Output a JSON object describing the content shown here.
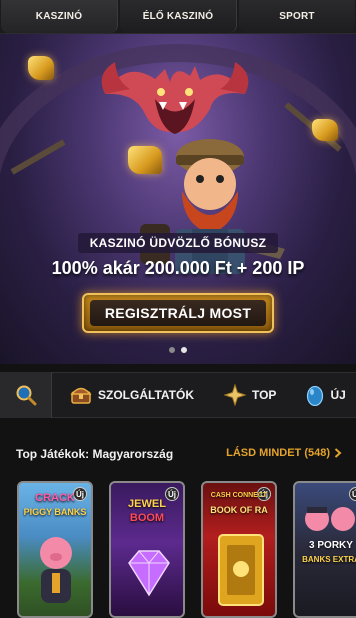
{
  "topnav": {
    "tabs": [
      {
        "label": "KASZINÓ"
      },
      {
        "label": "ÉLŐ KASZINÓ"
      },
      {
        "label": "SPORT"
      }
    ]
  },
  "hero": {
    "bonus_title": "KASZINÓ ÜDVÖZLŐ BÓNUSZ",
    "bonus_amount": "100% akár 200.000 Ft + 200 IP",
    "cta_label": "REGISZTRÁLJ MOST",
    "slides_total": 2,
    "slides_active": 1
  },
  "categories": {
    "items": [
      {
        "label": "SZOLGÁLTATÓK",
        "icon": "chest-icon"
      },
      {
        "label": "TOP",
        "icon": "star-icon"
      },
      {
        "label": "ÚJ",
        "icon": "egg-icon"
      }
    ]
  },
  "section": {
    "title": "Top Játékok: Magyarország",
    "see_all": "LÁSD MINDET (548)"
  },
  "games": [
    {
      "title_a": "CRACK",
      "title_b": "PIGGY BANKS",
      "badge": "Új"
    },
    {
      "title_a": "JEWEL",
      "title_b": "BOOM",
      "badge": "Új"
    },
    {
      "title_a": "CASH CONNECT",
      "title_b": "BOOK OF RA",
      "badge": "Új"
    },
    {
      "title_a": "3 PORKY",
      "title_b": "BANKS EXTRA",
      "badge": "Új"
    }
  ],
  "colors": {
    "accent": "#e4a32a",
    "background": "#121213"
  }
}
